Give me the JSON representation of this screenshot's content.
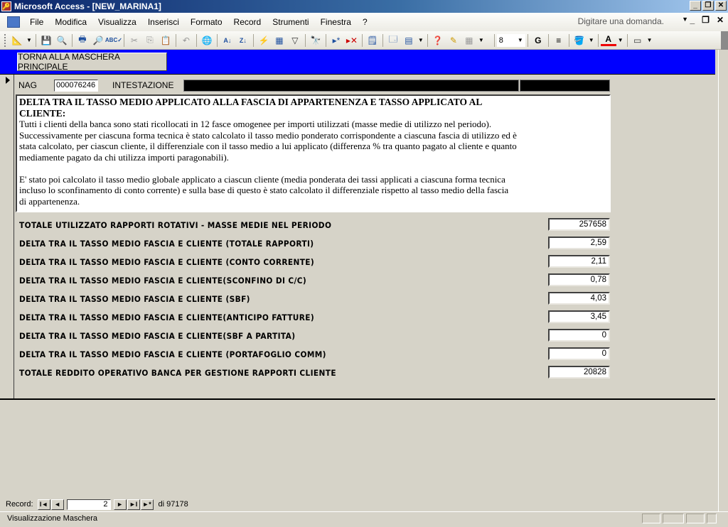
{
  "window": {
    "title": "Microsoft Access - [NEW_MARINA1]",
    "buttons": {
      "minimize": "_",
      "restore": "❐",
      "close": "✕"
    }
  },
  "menubar": {
    "items": [
      "File",
      "Modifica",
      "Visualizza",
      "Inserisci",
      "Formato",
      "Record",
      "Strumenti",
      "Finestra",
      "?"
    ],
    "help_placeholder": "Digitare una domanda.",
    "mdi_buttons": {
      "minimize": "_",
      "restore": "❐",
      "close": "✕"
    }
  },
  "toolbar": {
    "icons": [
      "design-view-icon",
      "save-icon",
      "search-file-icon",
      "print-icon",
      "print-preview-icon",
      "spelling-icon",
      "cut-icon",
      "copy-icon",
      "paste-icon",
      "undo-icon",
      "insert-hyperlink-icon",
      "sort-ascending-icon",
      "sort-descending-icon",
      "filter-by-selection-icon",
      "filter-by-form-icon",
      "apply-filter-icon",
      "find-icon",
      "new-record-icon",
      "delete-record-icon",
      "properties-icon",
      "database-window-icon",
      "new-object-icon",
      "help-icon"
    ],
    "font_size": "8",
    "bold_label": "G"
  },
  "form": {
    "back_button": "TORNA ALLA MASCHERA PRINCIPALE",
    "nag_label": "NAG",
    "nag_value": "000076246",
    "intestazione_label": "INTESTAZIONE",
    "intestazione_value": "",
    "memo": {
      "title": "DELTA TRA IL TASSO  MEDIO APPLICATO ALLA FASCIA DI APPARTENENZA E TASSO APPLICATO  AL CLIENTE:",
      "paragraph1": "Tutti i clienti della banca sono stati ricollocati in 12 fasce omogenee per importi utilizzati (masse medie di utilizzo nel periodo). Successivamente per ciascuna forma tecnica è stato calcolato il tasso medio ponderato corrispondente a ciascuna fascia di utilizzo ed è stata calcolato, per ciascun cliente, il differenziale con il tasso medio a lui applicato (differenza % tra quanto pagato al cliente e quanto mediamente pagato da chi utilizza importi paragonabili).",
      "paragraph2": "E' stato poi calcolato il tasso medio globale applicato a ciascun cliente (media ponderata dei tassi applicati a ciascuna forma tecnica incluso lo sconfinamento di conto corrente) e sulla base di questo è stato calcolato il differenziale rispetto al tasso medio della fascia di appartenenza."
    },
    "rows": [
      {
        "label": "TOTALE UTILIZZATO RAPPORTI ROTATIVI - MASSE MEDIE NEL PERIODO",
        "value": "257658"
      },
      {
        "label": "DELTA TRA IL TASSO MEDIO FASCIA E CLIENTE (TOTALE RAPPORTI)",
        "value": "2,59"
      },
      {
        "label": "DELTA TRA IL TASSO MEDIO FASCIA E CLIENTE (CONTO CORRENTE)",
        "value": "2,11"
      },
      {
        "label": "DELTA TRA IL TASSO MEDIO FASCIA E CLIENTE(SCONFINO DI C/C)",
        "value": "0,78"
      },
      {
        "label": "DELTA TRA IL TASSO MEDIO FASCIA E CLIENTE (SBF)",
        "value": "4,03"
      },
      {
        "label": "DELTA TRA IL TASSO MEDIO FASCIA E CLIENTE(ANTICIPO FATTURE)",
        "value": "3,45"
      },
      {
        "label": "DELTA TRA IL TASSO MEDIO FASCIA E CLIENTE(SBF A PARTITA)",
        "value": "0"
      },
      {
        "label": "DELTA TRA IL TASSO MEDIO FASCIA E CLIENTE (PORTAFOGLIO COMM)",
        "value": "0"
      },
      {
        "label": "TOTALE REDDITO OPERATIVO BANCA PER GESTIONE RAPPORTI CLIENTE",
        "value": "20828"
      }
    ]
  },
  "navigation": {
    "label": "Record:",
    "current": "2",
    "total_text": "di 97178",
    "buttons": {
      "first": "I◄",
      "prev": "◄",
      "next": "►",
      "last": "►I",
      "new": "►*"
    }
  },
  "status": {
    "text": "Visualizzazione Maschera"
  },
  "colors": {
    "form_header": "#0000ff",
    "background": "#d6d3c8"
  }
}
